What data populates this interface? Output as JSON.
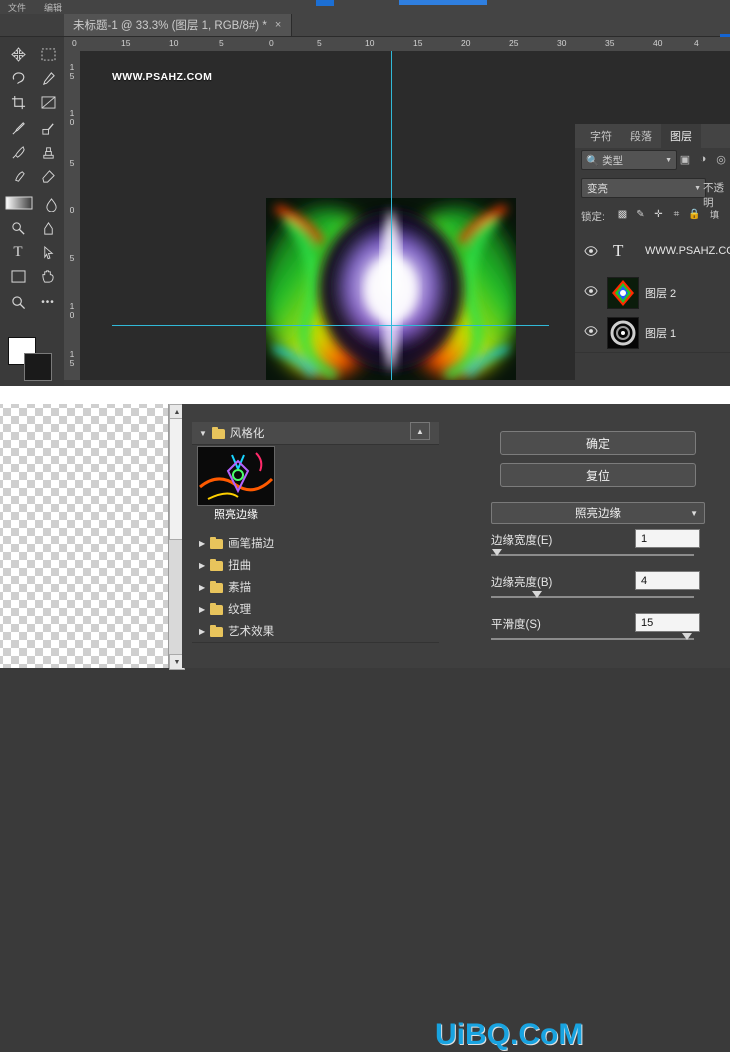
{
  "menubar": {
    "items": [
      {
        "label": "文件",
        "x": 8
      },
      {
        "label": "编辑",
        "x": 44
      }
    ]
  },
  "tab": {
    "title": "未标题-1 @ 33.3% (图层 1, RGB/8#) *",
    "close": "×"
  },
  "rulers": {
    "horizontal": [
      "0",
      "15",
      "10",
      "5",
      "0",
      "5",
      "10",
      "15",
      "20",
      "25",
      "30",
      "35",
      "40",
      "4"
    ],
    "vertical": [
      "1",
      "5",
      "1",
      "0",
      "5",
      "0",
      "5",
      "1",
      "0",
      "1",
      "5"
    ]
  },
  "toolbar": {
    "tools": [
      {
        "name": "move-tool",
        "glyph": "✛"
      },
      {
        "name": "marquee-tool",
        "glyph": "▭"
      },
      {
        "name": "lasso-tool",
        "glyph": "✎"
      },
      {
        "name": "quick-select-tool",
        "glyph": "✐"
      },
      {
        "name": "crop-tool",
        "glyph": "⌗"
      },
      {
        "name": "slice-tool",
        "glyph": "✂"
      },
      {
        "name": "eyedropper-tool",
        "glyph": "⌖"
      },
      {
        "name": "healing-brush-tool",
        "glyph": "✚"
      },
      {
        "name": "brush-tool",
        "glyph": "✒"
      },
      {
        "name": "clone-stamp-tool",
        "glyph": "♜"
      },
      {
        "name": "history-brush-tool",
        "glyph": "✜"
      },
      {
        "name": "eraser-tool",
        "glyph": "◧"
      },
      {
        "name": "gradient-tool",
        "glyph": "▥"
      },
      {
        "name": "blur-tool",
        "glyph": "◍"
      },
      {
        "name": "dodge-tool",
        "glyph": "◐"
      },
      {
        "name": "pen-tool",
        "glyph": "✑"
      },
      {
        "name": "type-tool",
        "glyph": "T"
      },
      {
        "name": "path-selection-tool",
        "glyph": "➤"
      },
      {
        "name": "shape-tool",
        "glyph": "▭"
      },
      {
        "name": "hand-tool",
        "glyph": "✋"
      },
      {
        "name": "zoom-tool",
        "glyph": "🔍"
      },
      {
        "name": "more-tools",
        "glyph": "•••"
      }
    ],
    "foreground_color": "#ffffff",
    "background_color": "#1a1a1a"
  },
  "canvas": {
    "watermark": "WWW.PSAHZ.COM",
    "guide_color": "#31b9d8"
  },
  "layers_panel": {
    "tabs": [
      {
        "label": "字符",
        "active": false
      },
      {
        "label": "段落",
        "active": false
      },
      {
        "label": "图层",
        "active": true
      }
    ],
    "filter_placeholder": "类型",
    "blend_mode": "变亮",
    "opacity_label": "不透明",
    "lock_label": "锁定:",
    "layers": [
      {
        "name": "WWW.PSAHZ.CO",
        "kind": "text"
      },
      {
        "name": "图层 2",
        "kind": "image"
      },
      {
        "name": "图层 1",
        "kind": "image"
      }
    ]
  },
  "filter_gallery": {
    "collapse_glyph": "▲",
    "category": {
      "title": "风格化",
      "expanded_triangle": "▼"
    },
    "selected_thumb_caption": "照亮边缘",
    "categories": [
      {
        "label": "画笔描边",
        "triangle": "▶"
      },
      {
        "label": "扭曲",
        "triangle": "▶"
      },
      {
        "label": "素描",
        "triangle": "▶"
      },
      {
        "label": "纹理",
        "triangle": "▶"
      },
      {
        "label": "艺术效果",
        "triangle": "▶"
      }
    ],
    "buttons": {
      "ok": "确定",
      "reset": "复位"
    },
    "filter_select": "照亮边缘",
    "sliders": [
      {
        "label": "边缘宽度(E)",
        "value": "1",
        "pct": 3
      },
      {
        "label": "边缘亮度(B)",
        "value": "4",
        "pct": 25
      },
      {
        "label": "平滑度(S)",
        "value": "15",
        "pct": 93
      }
    ]
  },
  "watermark_bottom": "UiBQ.CoM"
}
